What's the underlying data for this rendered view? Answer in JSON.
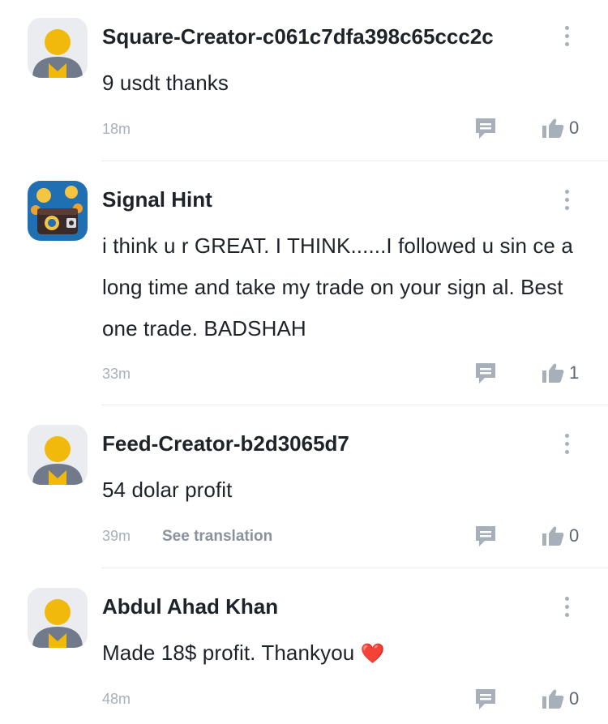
{
  "comments": [
    {
      "username": "Square-Creator-c061c7dfa398c65ccc2c",
      "avatar": "default-avatar",
      "text": "9 usdt thanks",
      "time": "18m",
      "translation_link": "",
      "likes": "0"
    },
    {
      "username": "Signal Hint",
      "avatar": "crypto-wallet-avatar",
      "text": "i think u r GREAT. I THINK......I followed u sin ce a long time and take my trade on your sign al. Best one trade. BADSHAH",
      "time": "33m",
      "translation_link": "",
      "likes": "1"
    },
    {
      "username": "Feed-Creator-b2d3065d7",
      "avatar": "default-avatar",
      "text": "54 dolar profit",
      "time": "39m",
      "translation_link": "See translation",
      "likes": "0"
    },
    {
      "username": "Abdul Ahad Khan",
      "avatar": "default-avatar",
      "text": "Made 18$ profit. Thankyou",
      "emoji": "❤️",
      "time": "48m",
      "translation_link": "",
      "likes": "0"
    }
  ],
  "icons": {
    "more": "more-vertical-icon",
    "reply": "comment-icon",
    "like": "thumbs-up-icon"
  },
  "colors": {
    "text": "#1e2329",
    "muted": "#a7afba",
    "icon": "#a7afba",
    "avatar_yellow": "#f0b90b",
    "avatar_bg": "#eaecef"
  }
}
